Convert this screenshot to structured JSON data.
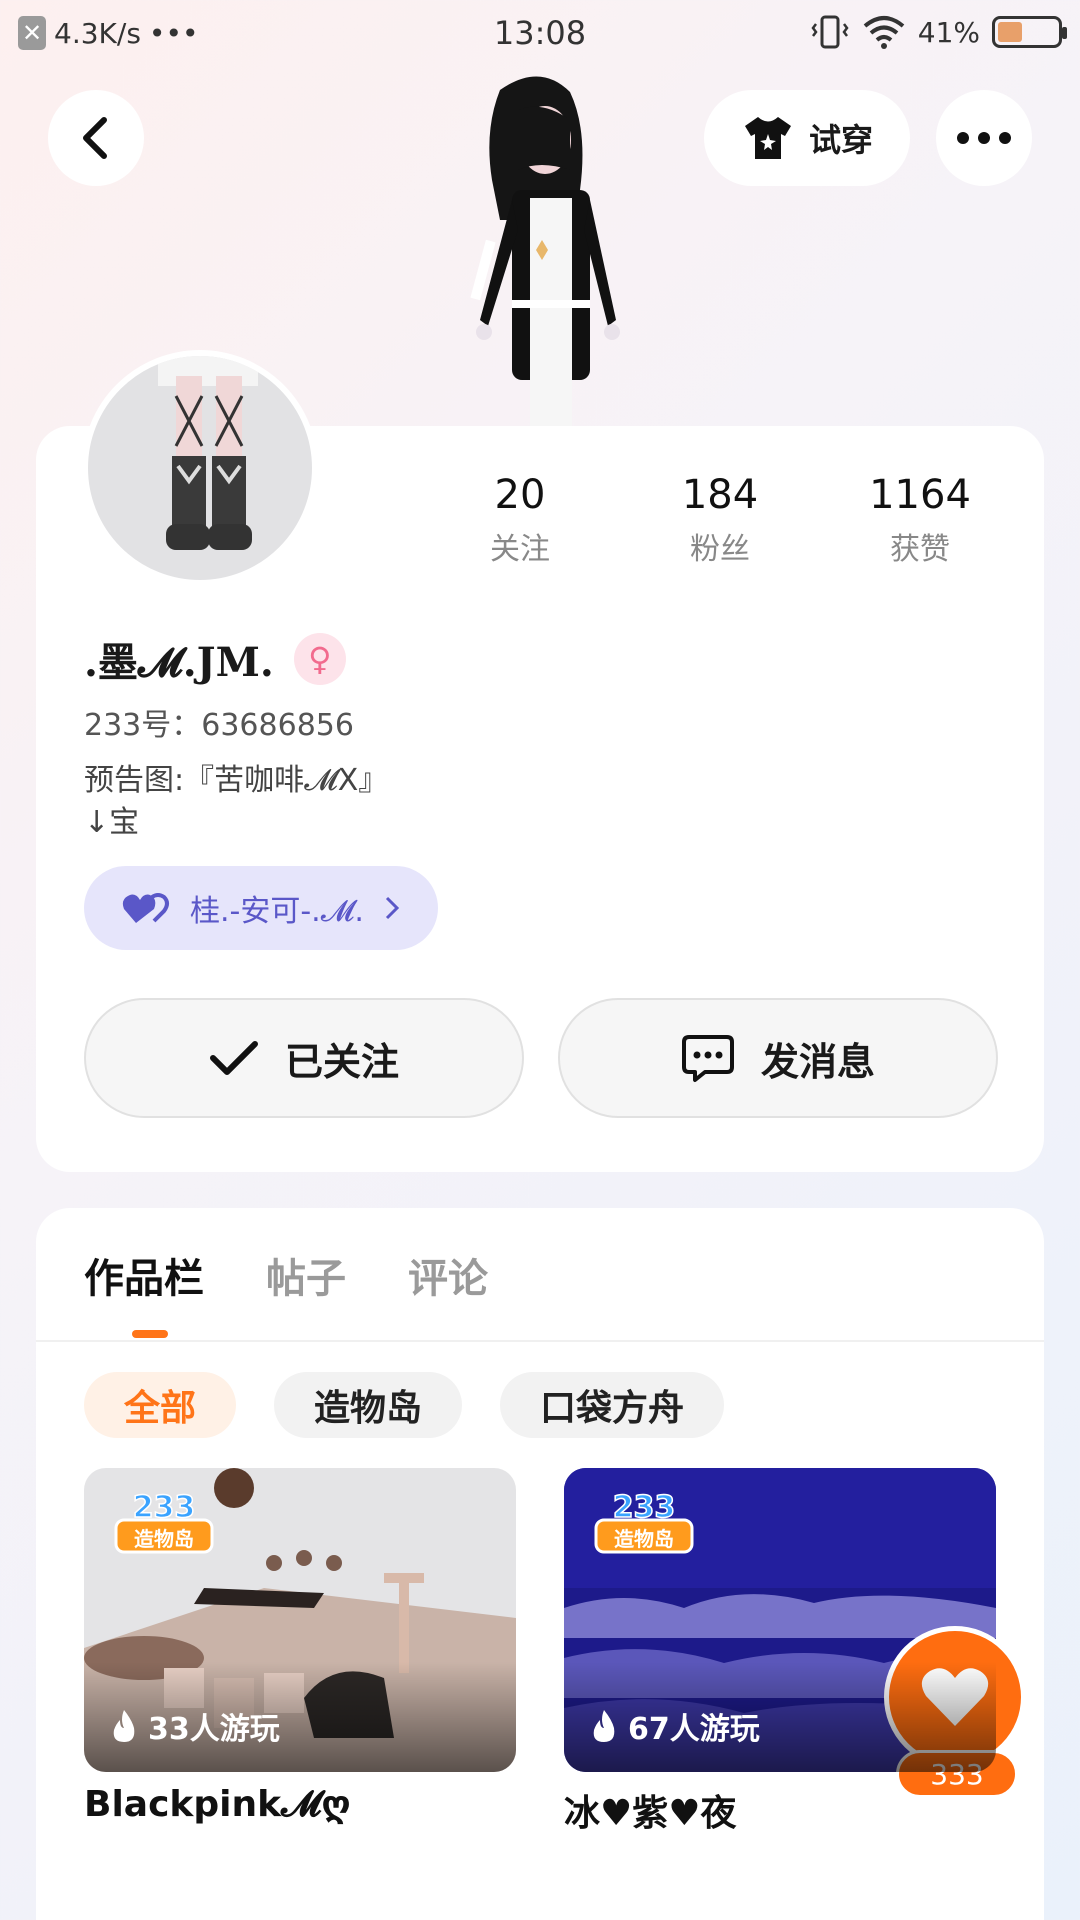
{
  "status_bar": {
    "net_speed": "4.3K/s",
    "dots": "•••",
    "time": "13:08",
    "battery": "41%",
    "battery_level": 0.41
  },
  "nav": {
    "try_on_label": "试穿"
  },
  "profile": {
    "stats": [
      {
        "value": "20",
        "label": "关注"
      },
      {
        "value": "184",
        "label": "粉丝"
      },
      {
        "value": "1164",
        "label": "获赞"
      }
    ],
    "name": ".墨𝓜.JM.",
    "uid": "233号：63686856",
    "bio_line1": "预告图:『苦咖啡𝓜X』",
    "bio_line2": "↓宝",
    "friend_tag": "桂.-安可-.𝓜.",
    "followed_label": "已关注",
    "message_label": "发消息"
  },
  "works": {
    "tabs": [
      "作品栏",
      "帖子",
      "评论"
    ],
    "filters": [
      "全部",
      "造物岛",
      "口袋方舟"
    ],
    "games": [
      {
        "title": "Blackpink𝓜ღ",
        "plays": "33人游玩"
      },
      {
        "title": "冰♥紫♥夜",
        "plays": "67人游玩"
      }
    ],
    "badge_text_top": "233",
    "badge_text_bottom": "造物岛",
    "like_count": "333"
  },
  "colors": {
    "accent": "#ff7418",
    "friend_tag_bg": "#e6e5fb",
    "friend_tag_text": "#5a57c8"
  }
}
